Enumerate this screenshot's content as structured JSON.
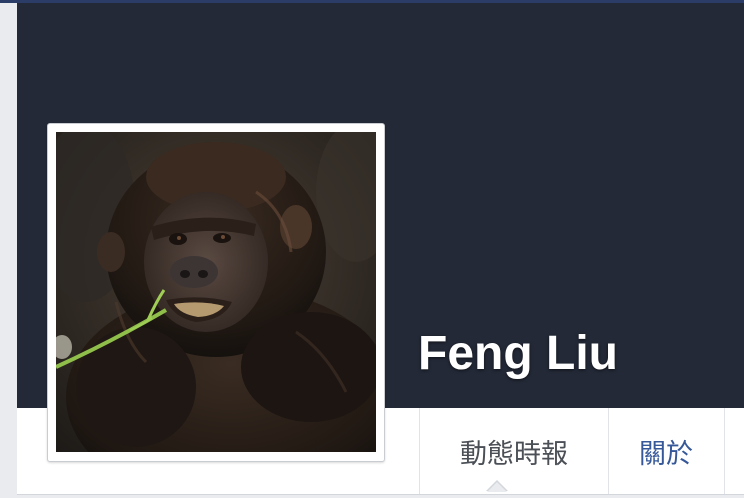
{
  "profile": {
    "name": "Feng Liu",
    "photo_subject": "baby gorilla chewing a green stem"
  },
  "nav": {
    "tabs": [
      {
        "label": "動態時報",
        "active": true
      },
      {
        "label": "關於",
        "active": false
      }
    ]
  },
  "colors": {
    "cover": "#232937",
    "link": "#365899",
    "tab_text": "#4b4f56",
    "page_bg": "#e9ebee"
  }
}
